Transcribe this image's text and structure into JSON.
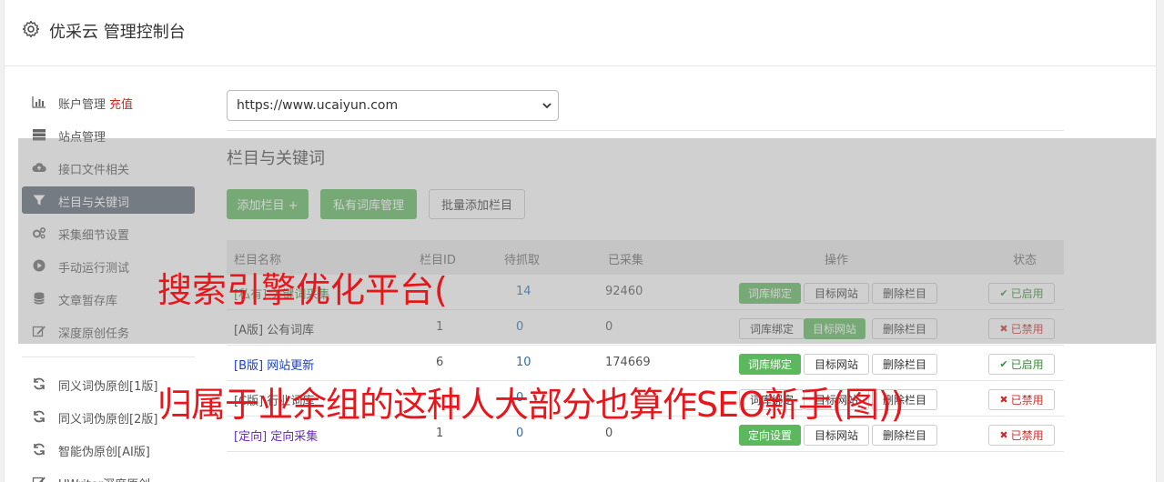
{
  "header": {
    "title": "优采云 管理控制台"
  },
  "sidebar": {
    "items": [
      {
        "label": "账户管理",
        "icon": "bar-chart-icon",
        "extra": "充值"
      },
      {
        "label": "站点管理",
        "icon": "server-icon"
      },
      {
        "label": "接口文件相关",
        "icon": "cloud-upload-icon"
      },
      {
        "label": "栏目与关键词",
        "icon": "filter-icon",
        "active": true
      },
      {
        "label": "采集细节设置",
        "icon": "cogs-icon"
      },
      {
        "label": "手动运行测试",
        "icon": "play-circle-icon"
      },
      {
        "label": "文章暂存库",
        "icon": "database-icon"
      },
      {
        "label": "深度原创任务",
        "icon": "edit-icon"
      },
      {
        "label": "同义词伪原创[1版]",
        "icon": "refresh-icon"
      },
      {
        "label": "同义词伪原创[2版]",
        "icon": "refresh-icon"
      },
      {
        "label": "智能伪原创[AI版]",
        "icon": "refresh-icon"
      },
      {
        "label": "UWriter深度原创",
        "icon": "edit-icon"
      }
    ]
  },
  "site_select": {
    "value": "https://www.ucaiyun.com"
  },
  "main": {
    "section_title": "栏目与关键词",
    "buttons": {
      "add_column": "添加栏目 +",
      "private_lexicon": "私有词库管理",
      "batch_add": "批量添加栏目"
    }
  },
  "table": {
    "headers": [
      "栏目名称",
      "栏目ID",
      "待抓取",
      "已采集",
      "操作",
      "状态"
    ],
    "rows": [
      {
        "name": "[私有] 关键词采集",
        "name_color": "#3c8a3c",
        "id": "",
        "pending": "14",
        "collected": "92460",
        "actions": [
          "词库绑定",
          "目标网站",
          "删除栏目"
        ],
        "primary": 0,
        "status": "已启用",
        "on": true
      },
      {
        "name": "[A版] 公有词库",
        "name_color": "#333333",
        "id": "1",
        "pending": "0",
        "collected": "0",
        "actions": [
          "词库绑定",
          "目标网站",
          "删除栏目"
        ],
        "primary": 1,
        "status": "已禁用",
        "on": false
      },
      {
        "name": "[B版] 网站更新",
        "name_color": "#1a3fc4",
        "id": "6",
        "pending": "10",
        "collected": "174669",
        "actions": [
          "词库绑定",
          "目标网站",
          "删除栏目"
        ],
        "primary": 0,
        "status": "已启用",
        "on": true
      },
      {
        "name": "[C版] 行业词库",
        "name_color": "#555555",
        "id": "",
        "pending": "0",
        "collected": "",
        "actions": [
          "词库绑定",
          "目标网站",
          "删除栏目"
        ],
        "primary": -1,
        "status": "已禁用",
        "on": false
      },
      {
        "name": "[定向] 定向采集",
        "name_color": "#6a2bc4",
        "id": "1",
        "pending": "0",
        "collected": "0",
        "actions": [
          "定向设置",
          "目标网站",
          "删除栏目"
        ],
        "primary": 0,
        "status": "已禁用",
        "on": false
      }
    ]
  },
  "overlay_text": {
    "line1": "搜索引擎优化平台(",
    "line2": "归属于业余组的这种人大部分也算作SEO新手(图))"
  },
  "colors": {
    "accent_green": "#5cb85c",
    "active_nav": "#5a6472",
    "warning_red": "#e8161b"
  }
}
